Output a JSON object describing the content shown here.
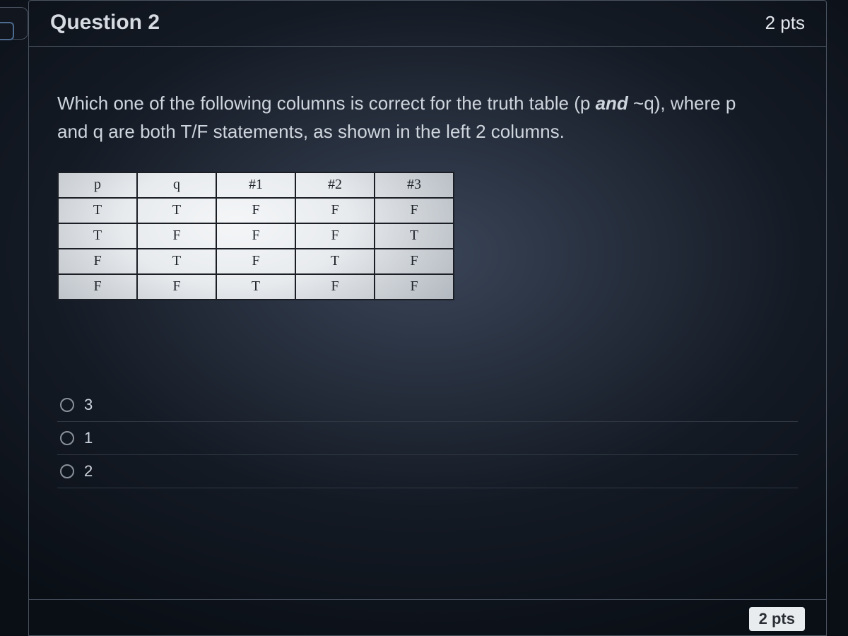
{
  "question": {
    "title": "Question 2",
    "points_top": "2 pts",
    "points_bottom": "2 pts",
    "prompt_part1": "Which one of the following columns is correct for the truth table (p ",
    "prompt_bold": "and",
    "prompt_part2": " ~q), where p and q are both T/F statements, as shown in the left 2 columns."
  },
  "table": {
    "headers": [
      "p",
      "q",
      "#1",
      "#2",
      "#3"
    ],
    "rows": [
      [
        "T",
        "T",
        "F",
        "F",
        "F"
      ],
      [
        "T",
        "F",
        "F",
        "F",
        "T"
      ],
      [
        "F",
        "T",
        "F",
        "T",
        "F"
      ],
      [
        "F",
        "F",
        "T",
        "F",
        "F"
      ]
    ]
  },
  "options": [
    {
      "label": "3"
    },
    {
      "label": "1"
    },
    {
      "label": "2"
    }
  ]
}
